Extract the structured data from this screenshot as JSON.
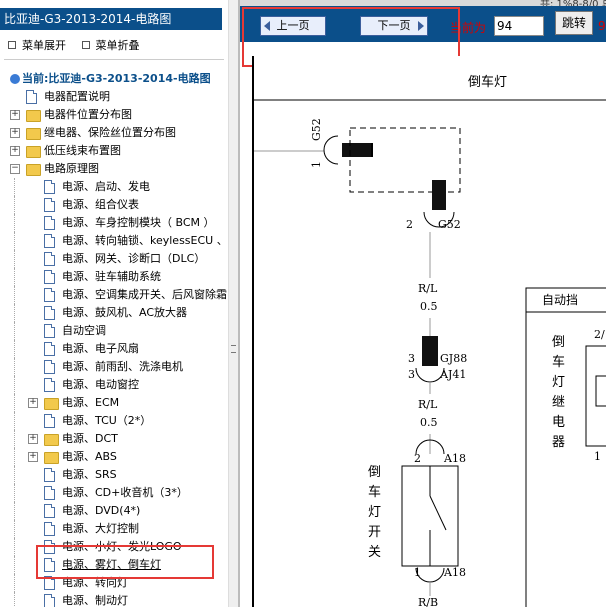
{
  "left_panel": {
    "title": "比亚迪-G3-2013-2014-电路图",
    "menu_expand": "菜单展开",
    "menu_collapse": "菜单折叠",
    "root": "当前:比亚迪-G3-2013-2014-电路图",
    "tree": [
      {
        "label": "电器配置说明",
        "kind": "doc",
        "level": 1,
        "expander": false
      },
      {
        "label": "电器件位置分布图",
        "kind": "folder",
        "level": 1,
        "expander": "plus"
      },
      {
        "label": "继电器、保险丝位置分布图",
        "kind": "folder",
        "level": 1,
        "expander": "plus"
      },
      {
        "label": "低压线束布置图",
        "kind": "folder",
        "level": 1,
        "expander": "plus"
      },
      {
        "label": "电路原理图",
        "kind": "folder-open",
        "level": 1,
        "expander": "minus"
      },
      {
        "label": "电源、启动、发电",
        "kind": "doc",
        "level": 2,
        "expander": false
      },
      {
        "label": "电源、组合仪表",
        "kind": "doc",
        "level": 2,
        "expander": false
      },
      {
        "label": "电源、车身控制模块（ BCM ）",
        "kind": "doc",
        "level": 2,
        "expander": false
      },
      {
        "label": "电源、转向轴锁、keylessECU 、",
        "kind": "doc",
        "level": 2,
        "expander": false
      },
      {
        "label": "电源、网关、诊断口（DLC）",
        "kind": "doc",
        "level": 2,
        "expander": false
      },
      {
        "label": "电源、驻车辅助系统",
        "kind": "doc",
        "level": 2,
        "expander": false
      },
      {
        "label": "电源、空调集成开关、后风窗除霜",
        "kind": "doc",
        "level": 2,
        "expander": false
      },
      {
        "label": "电源、鼓风机、AC放大器",
        "kind": "doc",
        "level": 2,
        "expander": false
      },
      {
        "label": "自动空调",
        "kind": "doc",
        "level": 2,
        "expander": false
      },
      {
        "label": "电源、电子风扇",
        "kind": "doc",
        "level": 2,
        "expander": false
      },
      {
        "label": "电源、前雨刮、洗涤电机",
        "kind": "doc",
        "level": 2,
        "expander": false
      },
      {
        "label": "电源、电动窗控",
        "kind": "doc",
        "level": 2,
        "expander": false
      },
      {
        "label": "电源、ECM",
        "kind": "folder",
        "level": 2,
        "expander": "plus"
      },
      {
        "label": "电源、TCU（2*）",
        "kind": "doc",
        "level": 2,
        "expander": false
      },
      {
        "label": "电源、DCT",
        "kind": "folder",
        "level": 2,
        "expander": "plus"
      },
      {
        "label": "电源、ABS",
        "kind": "folder",
        "level": 2,
        "expander": "plus"
      },
      {
        "label": "电源、SRS",
        "kind": "doc",
        "level": 2,
        "expander": false
      },
      {
        "label": "电源、CD+收音机（3*）",
        "kind": "doc",
        "level": 2,
        "expander": false
      },
      {
        "label": "电源、DVD(4*)",
        "kind": "doc",
        "level": 2,
        "expander": false
      },
      {
        "label": "电源、大灯控制",
        "kind": "doc",
        "level": 2,
        "expander": false
      },
      {
        "label": "电源、小灯、发光LOGO",
        "kind": "doc",
        "level": 2,
        "expander": false
      },
      {
        "label": "电源、雾灯、倒车灯",
        "kind": "doc",
        "level": 2,
        "expander": false,
        "selected": true
      },
      {
        "label": "电源、转向灯",
        "kind": "doc",
        "level": 2,
        "expander": false
      },
      {
        "label": "电源、制动灯",
        "kind": "doc",
        "level": 2,
        "expander": false
      }
    ]
  },
  "toolbar": {
    "prev_label": "上一页",
    "next_label": "下一页",
    "current_label": "当前为",
    "page_value": "94",
    "jump_label": "跳转",
    "trailing_text": "94",
    "top_right_text": "共: 1%8-8/0 总"
  },
  "diagram": {
    "title": "倒车灯",
    "labels": {
      "g52_top": "G52",
      "g52_pin1": "1",
      "g52_pin2": "2",
      "g52_bottom": "G52",
      "wire1_color": "R/L",
      "wire1_size": "0.5",
      "gj88_pin": "3",
      "gj88": "GJ88",
      "aj41_pin": "3",
      "aj41": "AJ41",
      "wire2_color": "R/L",
      "wire2_size": "0.5",
      "switch_pin2": "2",
      "a18_top": "A18",
      "switch_name": "倒车灯开关",
      "switch_pin1": "1",
      "a18_bottom": "A18",
      "wire3_color": "R/B",
      "auto_gear": "自动挡",
      "relay_name": "倒车灯继电器",
      "relay_pin2": "2/",
      "relay_pin1": "1"
    }
  },
  "colors": {
    "title_bar": "#0b4f8a",
    "highlight_box": "#e53935",
    "red_text": "#d40000"
  }
}
